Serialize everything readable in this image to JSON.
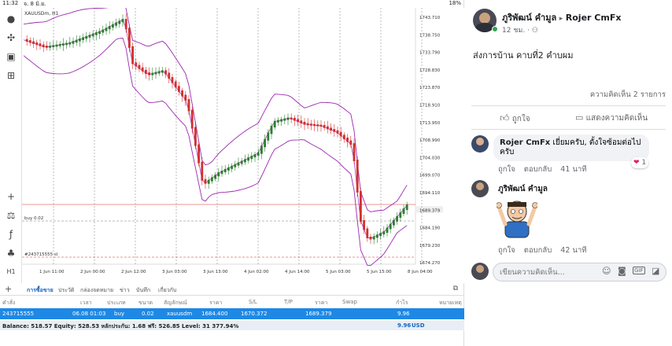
{
  "status": {
    "time": "11:32",
    "date": "จ. 8 มิ.ย.",
    "battery": "18%"
  },
  "chart": {
    "symbol": "XAUUSDm, H1",
    "price_ticks": [
      "1743.710",
      "1738.750",
      "1733.790",
      "1728.830",
      "1723.870",
      "1718.910",
      "1713.950",
      "1708.990",
      "1704.030",
      "1699.070",
      "1694.110",
      "1689.379",
      "1684.190",
      "1679.230",
      "1674.270"
    ],
    "current_price": "1689.379",
    "time_ticks": [
      "1 Jun 11:00",
      "2 Jun 00:00",
      "2 Jun 12:00",
      "3 Jun 03:00",
      "3 Jun 13:00",
      "4 Jun 02:00",
      "4 Jun 14:00",
      "5 Jun 03:00",
      "5 Jun 15:00",
      "8 Jun 04:00"
    ],
    "buy_label": "buy 0.02",
    "order_label": "#243715555 sl",
    "colors": {
      "bull": "#2e7d32",
      "bear": "#d32f2f",
      "band": "#9c27b0",
      "grid": "#555555"
    }
  },
  "trade": {
    "tabs": [
      "การซื้อขาย",
      "ประวัติ",
      "กล่องจดหมาย",
      "ข่าว",
      "บันทึก",
      "เกี่ยวกับ"
    ],
    "headers": [
      "คำสั่ง",
      "เวลา",
      "ประเภท",
      "ขนาด",
      "สัญลักษณ์",
      "ราคา",
      "S/L",
      "T/P",
      "ราคา",
      "Swap",
      "กำไร",
      "หมายเหตุ"
    ],
    "row": [
      "243715555",
      "06.08 01:03",
      "buy",
      "0.02",
      "xauusdm",
      "1684.400",
      "1670.372",
      "",
      "1689.379",
      "",
      "9.96",
      ""
    ],
    "balance": "Balance: 518.57 Equity: 528.53 หลักประกัน: 1.68 ฟรี: 526.85 Level: 31 377.94%",
    "balance_profit": "9.96",
    "balance_currency": "USD"
  },
  "post": {
    "author": "ภูริพัฒน์ คำมูล",
    "arrow": "▸",
    "group": "Rojer CmFx",
    "time": "12 ชม.",
    "text": "ส่งการบ้าน คาบที่2 คำบผม",
    "comments_count": "ความคิดเห็น 2 รายการ",
    "like": "ถูกใจ",
    "comment": "แสดงความคิดเห็น"
  },
  "comments": [
    {
      "name": "Rojer CmFx",
      "text": "เยี่ยมครับ, ตั้งใจซ้อมต่อไปครับ",
      "like": "ถูกใจ",
      "reply": "ตอบกลับ",
      "time": "41 นาที",
      "reactions": "1"
    },
    {
      "name": "ภูริพัฒน์ คำมูล",
      "text": "",
      "like": "ถูกใจ",
      "reply": "ตอบกลับ",
      "time": "42 นาที"
    }
  ],
  "composer": {
    "placeholder": "เขียนความคิดเห็น..."
  }
}
